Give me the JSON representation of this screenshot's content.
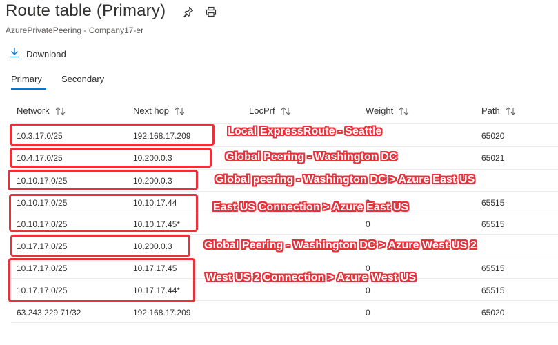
{
  "header": {
    "title": "Route table (Primary)",
    "subtitle": "AzurePrivatePeering - Company17-er",
    "pin_icon": "pin-icon",
    "print_icon": "print-icon"
  },
  "toolbar": {
    "download_label": "Download",
    "download_icon": "download-icon"
  },
  "tabs": [
    {
      "label": "Primary",
      "selected": true
    },
    {
      "label": "Secondary",
      "selected": false
    }
  ],
  "table": {
    "columns": [
      "Network",
      "Next hop",
      "LocPrf",
      "Weight",
      "Path"
    ],
    "rows": [
      {
        "network": "10.3.17.0/25",
        "next_hop": "192.168.17.209",
        "locprf": "",
        "weight": "",
        "path": "65020"
      },
      {
        "network": "10.4.17.0/25",
        "next_hop": "10.200.0.3",
        "locprf": "",
        "weight": "",
        "path": "65021"
      },
      {
        "network": "10.10.17.0/25",
        "next_hop": "10.200.0.3",
        "locprf": "",
        "weight": "",
        "path": ""
      },
      {
        "network": "10.10.17.0/25",
        "next_hop": "10.10.17.44",
        "locprf": "",
        "weight": "0",
        "path": "65515"
      },
      {
        "network": "10.10.17.0/25",
        "next_hop": "10.10.17.45*",
        "locprf": "",
        "weight": "0",
        "path": "65515"
      },
      {
        "network": "10.17.17.0/25",
        "next_hop": "10.200.0.3",
        "locprf": "",
        "weight": "",
        "path": ""
      },
      {
        "network": "10.17.17.0/25",
        "next_hop": "10.17.17.45",
        "locprf": "",
        "weight": "0",
        "path": "65515"
      },
      {
        "network": "10.17.17.0/25",
        "next_hop": "10.17.17.44*",
        "locprf": "",
        "weight": "0",
        "path": "65515"
      },
      {
        "network": "63.243.229.71/32",
        "next_hop": "192.168.17.209",
        "locprf": "",
        "weight": "0",
        "path": "65020"
      }
    ]
  },
  "annotations": [
    "Local ExpressRoute - Seattle",
    "Global Peering - Washington DC",
    "Global peering - Washington DC > Azure East US",
    "East US Connection > Azure East US",
    "Global Peering - Washington DC > Azure West US 2",
    "West US 2 Connection  > Azure West US"
  ],
  "colors": {
    "accent": "#0078d4",
    "annotation_red": "#e8313a",
    "text": "#323130",
    "muted": "#605e5c"
  }
}
